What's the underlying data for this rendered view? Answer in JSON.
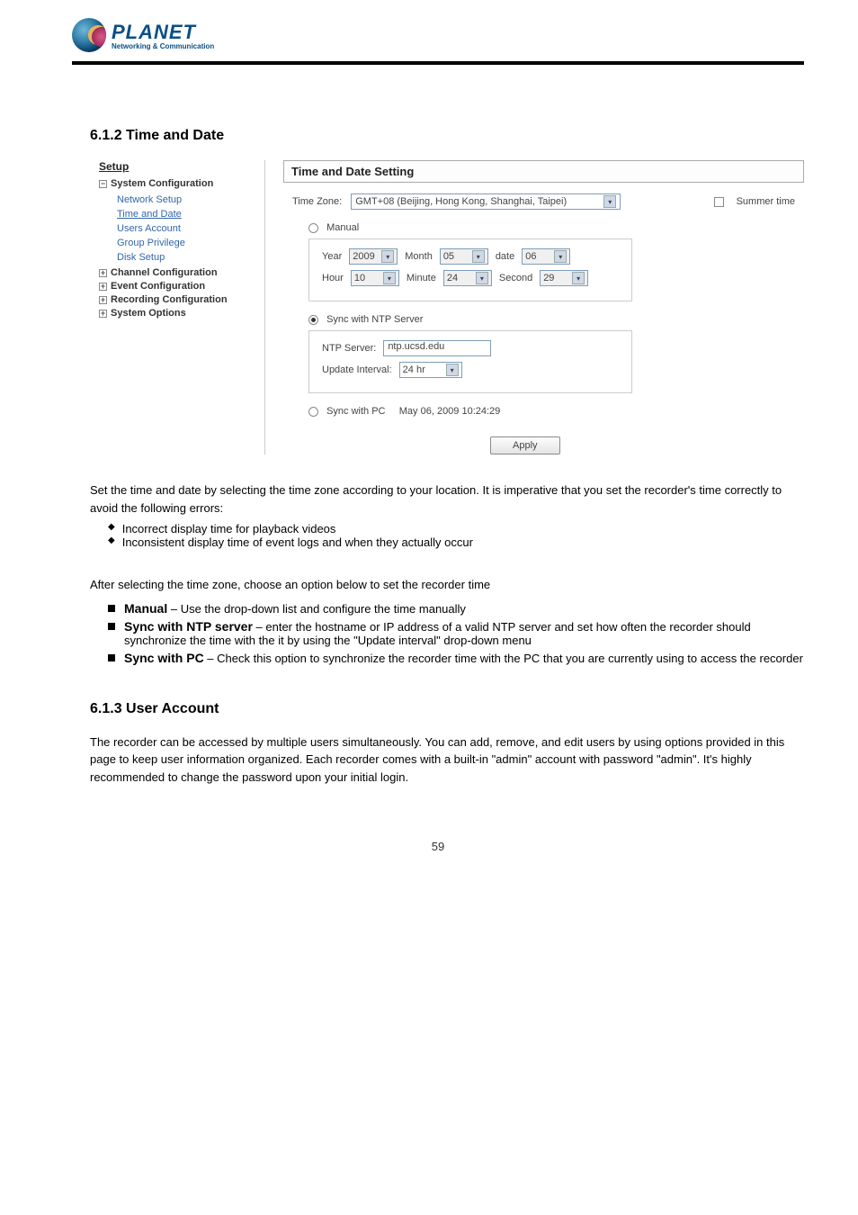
{
  "logo": {
    "brand": "PLANET",
    "tagline": "Networking & Communication"
  },
  "section_612": {
    "heading": "6.1.2 Time and Date",
    "nav": {
      "setup": "Setup",
      "system_config": "System Configuration",
      "items": [
        "Network Setup",
        "Time and Date",
        "Users Account",
        "Group Privilege",
        "Disk Setup"
      ],
      "collapsed": [
        "Channel Configuration",
        "Event Configuration",
        "Recording Configuration",
        "System Options"
      ]
    },
    "panel": {
      "title": "Time and Date Setting",
      "tz_label": "Time Zone:",
      "tz_value": "GMT+08 (Beijing, Hong Kong, Shanghai, Taipei)",
      "summer_label": "Summer time",
      "manual": {
        "label": "Manual",
        "year_l": "Year",
        "year_v": "2009",
        "month_l": "Month",
        "month_v": "05",
        "date_l": "date",
        "date_v": "06",
        "hour_l": "Hour",
        "hour_v": "10",
        "minute_l": "Minute",
        "minute_v": "24",
        "second_l": "Second",
        "second_v": "29"
      },
      "ntp": {
        "label": "Sync with NTP Server",
        "server_l": "NTP Server:",
        "server_v": "ntp.ucsd.edu",
        "interval_l": "Update Interval:",
        "interval_v": "24 hr"
      },
      "pc": {
        "label": "Sync with PC",
        "time": "May 06, 2009 10:24:29"
      },
      "apply": "Apply"
    },
    "para1": "Set the time and date by selecting the time zone according to your location. It is imperative that you set the recorder's time correctly to avoid the following errors:",
    "bullets": [
      "Incorrect display time for playback videos",
      "Inconsistent display time of event logs and when they actually occur"
    ],
    "para2": "After selecting the time zone, choose an option below to set the recorder time",
    "opts": {
      "manual_t": "Manual",
      "manual_d": " – Use the drop-down list and configure the time manually",
      "ntp_t": "Sync with NTP server",
      "ntp_d": " – enter the hostname or IP address of a valid NTP server and set how often the recorder should synchronize the time with the it by using the \"Update interval\" drop-down menu",
      "pc_t": "Sync with PC",
      "pc_d": " – Check this option to synchronize the recorder time with the PC that you are currently using to access the recorder"
    }
  },
  "section_613": {
    "heading": "6.1.3 User Account",
    "para": "The recorder can be accessed by multiple users simultaneously. You can add, remove, and edit users by using options provided in this page to keep user information organized. Each recorder comes with a built-in \"admin\" account with password \"admin\". It's highly recommended to change the password upon your initial login."
  },
  "page_number": "59"
}
